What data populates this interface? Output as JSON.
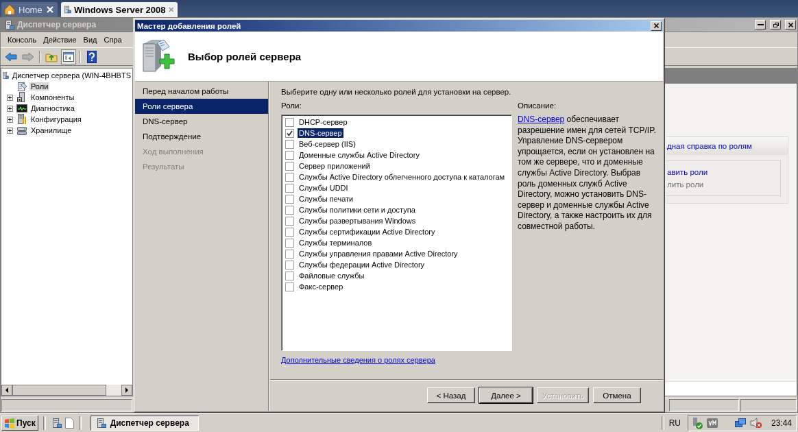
{
  "browser_tabs": [
    {
      "label": "Home",
      "selected": false
    },
    {
      "label": "Windows Server 2008",
      "selected": true
    }
  ],
  "server_manager": {
    "title": "Диспетчер сервера",
    "menu": [
      "Консоль",
      "Действие",
      "Вид",
      "Спра"
    ],
    "tree": {
      "label": "Диспетчер сервера (WIN-4BHBTS",
      "children": [
        {
          "label": "Роли",
          "kind": "roles",
          "selected": true,
          "expandable": false
        },
        {
          "label": "Компоненты",
          "kind": "components",
          "selected": false,
          "expandable": true
        },
        {
          "label": "Диагностика",
          "kind": "diagnostics",
          "selected": false,
          "expandable": true
        },
        {
          "label": "Конфигурация",
          "kind": "configuration",
          "selected": false,
          "expandable": true
        },
        {
          "label": "Хранилище",
          "kind": "storage",
          "selected": false,
          "expandable": true
        }
      ]
    },
    "roles_summary_panel": {
      "title": "дная справка по ролям",
      "links": [
        {
          "label": "авить роли",
          "disabled": false
        },
        {
          "label": "лить роли",
          "disabled": true
        }
      ]
    }
  },
  "wizard": {
    "title": "Мастер добавления ролей",
    "heading": "Выбор ролей сервера",
    "steps": [
      {
        "label": "Перед началом работы",
        "selected": false,
        "disabled": false
      },
      {
        "label": "Роли сервера",
        "selected": true,
        "disabled": false
      },
      {
        "label": "DNS-сервер",
        "selected": false,
        "disabled": false
      },
      {
        "label": "Подтверждение",
        "selected": false,
        "disabled": false
      },
      {
        "label": "Ход выполнения",
        "selected": false,
        "disabled": true
      },
      {
        "label": "Результаты",
        "selected": false,
        "disabled": true
      }
    ],
    "instruction": "Выберите одну или несколько ролей для установки на сервер.",
    "roles_label": "Роли:",
    "roles": [
      {
        "label": "DHCP-сервер",
        "checked": false,
        "selected": false
      },
      {
        "label": "DNS-сервер",
        "checked": true,
        "selected": true
      },
      {
        "label": "Веб-сервер (IIS)",
        "checked": false,
        "selected": false
      },
      {
        "label": "Доменные службы Active Directory",
        "checked": false,
        "selected": false
      },
      {
        "label": "Сервер приложений",
        "checked": false,
        "selected": false
      },
      {
        "label": "Службы Active Directory облегченного доступа к каталогам",
        "checked": false,
        "selected": false
      },
      {
        "label": "Службы UDDI",
        "checked": false,
        "selected": false
      },
      {
        "label": "Службы печати",
        "checked": false,
        "selected": false
      },
      {
        "label": "Службы политики сети и доступа",
        "checked": false,
        "selected": false
      },
      {
        "label": "Службы развертывания Windows",
        "checked": false,
        "selected": false
      },
      {
        "label": "Службы сертификации Active Directory",
        "checked": false,
        "selected": false
      },
      {
        "label": "Службы терминалов",
        "checked": false,
        "selected": false
      },
      {
        "label": "Службы управления правами Active Directory",
        "checked": false,
        "selected": false
      },
      {
        "label": "Службы федерации Active Directory",
        "checked": false,
        "selected": false
      },
      {
        "label": "Файловые службы",
        "checked": false,
        "selected": false
      },
      {
        "label": "Факс-сервер",
        "checked": false,
        "selected": false
      }
    ],
    "description_label": "Описание:",
    "description": {
      "link": "DNS-сервер",
      "text": " обеспечивает разрешение имен для сетей TCP/IP. Управление DNS-сервером упрощается, если он установлен на том же сервере, что и доменные службы Active Directory. Выбрав роль доменных служб Active Directory, можно установить DNS-сервер и доменные службы Active Directory, а также настроить их для совместной работы."
    },
    "more_info_link": "Дополнительные сведения о ролях сервера",
    "buttons": [
      {
        "label": "< Назад",
        "kind": "normal"
      },
      {
        "label": "Далее >",
        "kind": "default"
      },
      {
        "label": "Установить",
        "kind": "disabled"
      },
      {
        "label": "Отмена",
        "kind": "normal"
      }
    ]
  },
  "taskbar": {
    "start": "Пуск",
    "windows": [
      {
        "label": "Диспетчер сервера",
        "selected": true
      }
    ],
    "language": "RU",
    "clock": "23:44"
  }
}
